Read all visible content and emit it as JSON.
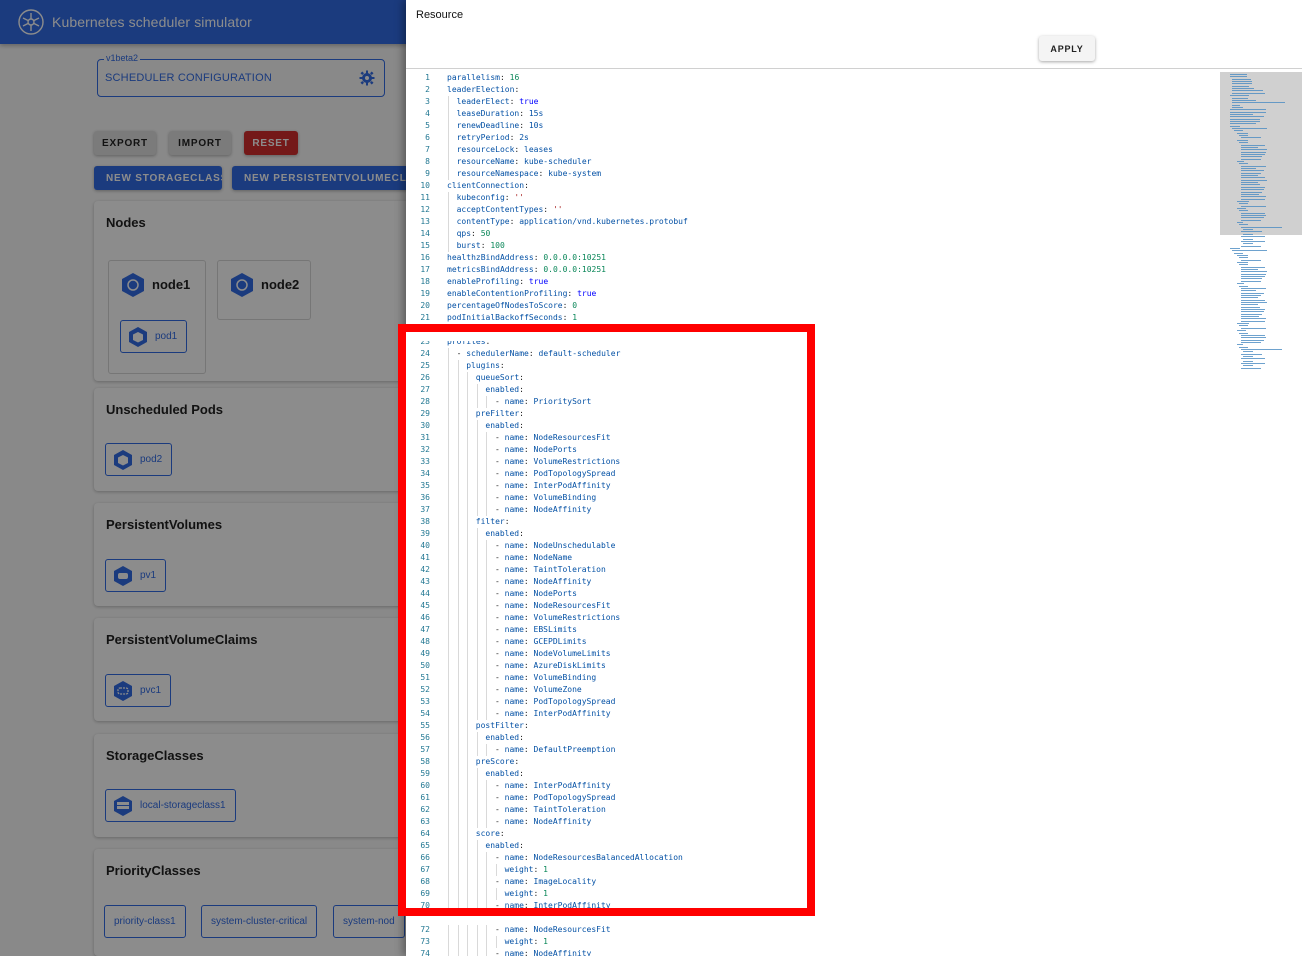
{
  "app": {
    "title": "Kubernetes scheduler simulator",
    "scheduler_config": {
      "legend": "v1beta2",
      "value": "SCHEDULER CONFIGURATION"
    },
    "buttons": {
      "export": "EXPORT",
      "import": "IMPORT",
      "reset": "RESET",
      "new_storageclass": "NEW STORAGECLASS",
      "new_pvc": "NEW PERSISTENTVOLUMECLAIM"
    },
    "sections": {
      "nodes": {
        "title": "Nodes",
        "nodes": [
          {
            "name": "node1",
            "pods": [
              "pod1"
            ]
          },
          {
            "name": "node2",
            "pods": []
          }
        ]
      },
      "unscheduled_pods": {
        "title": "Unscheduled Pods",
        "items": [
          "pod2"
        ]
      },
      "persistent_volumes": {
        "title": "PersistentVolumes",
        "items": [
          "pv1"
        ]
      },
      "persistent_volume_claims": {
        "title": "PersistentVolumeClaims",
        "items": [
          "pvc1"
        ]
      },
      "storage_classes": {
        "title": "StorageClasses",
        "items": [
          "local-storageclass1"
        ]
      },
      "priority_classes": {
        "title": "PriorityClasses",
        "items": [
          "priority-class1",
          "system-cluster-critical",
          "system-nod"
        ]
      }
    }
  },
  "drawer": {
    "title": "Resource",
    "apply_label": "APPLY",
    "editor": {
      "lines": [
        {
          "n": "1",
          "indent": 0,
          "key": "parallelism",
          "value": "16",
          "vtype": "n"
        },
        {
          "n": "2",
          "indent": 0,
          "key": "leaderElection",
          "value": "",
          "vtype": ""
        },
        {
          "n": "3",
          "indent": 1,
          "key": "leaderElect",
          "value": "true",
          "vtype": "b"
        },
        {
          "n": "4",
          "indent": 1,
          "key": "leaseDuration",
          "value": "15s",
          "vtype": "v"
        },
        {
          "n": "5",
          "indent": 1,
          "key": "renewDeadline",
          "value": "10s",
          "vtype": "v"
        },
        {
          "n": "6",
          "indent": 1,
          "key": "retryPeriod",
          "value": "2s",
          "vtype": "v"
        },
        {
          "n": "7",
          "indent": 1,
          "key": "resourceLock",
          "value": "leases",
          "vtype": "v"
        },
        {
          "n": "8",
          "indent": 1,
          "key": "resourceName",
          "value": "kube-scheduler",
          "vtype": "v"
        },
        {
          "n": "9",
          "indent": 1,
          "key": "resourceNamespace",
          "value": "kube-system",
          "vtype": "v"
        },
        {
          "n": "10",
          "indent": 0,
          "key": "clientConnection",
          "value": "",
          "vtype": ""
        },
        {
          "n": "11",
          "indent": 1,
          "key": "kubeconfig",
          "value": "''",
          "vtype": "s"
        },
        {
          "n": "12",
          "indent": 1,
          "key": "acceptContentTypes",
          "value": "''",
          "vtype": "s"
        },
        {
          "n": "13",
          "indent": 1,
          "key": "contentType",
          "value": "application/vnd.kubernetes.protobuf",
          "vtype": "v"
        },
        {
          "n": "14",
          "indent": 1,
          "key": "qps",
          "value": "50",
          "vtype": "n"
        },
        {
          "n": "15",
          "indent": 1,
          "key": "burst",
          "value": "100",
          "vtype": "n"
        },
        {
          "n": "16",
          "indent": 0,
          "key": "healthzBindAddress",
          "value": "0.0.0.0:10251",
          "vtype": "n"
        },
        {
          "n": "17",
          "indent": 0,
          "key": "metricsBindAddress",
          "value": "0.0.0.0:10251",
          "vtype": "n"
        },
        {
          "n": "18",
          "indent": 0,
          "key": "enableProfiling",
          "value": "true",
          "vtype": "b"
        },
        {
          "n": "19",
          "indent": 0,
          "key": "enableContentionProfiling",
          "value": "true",
          "vtype": "b"
        },
        {
          "n": "20",
          "indent": 0,
          "key": "percentageOfNodesToScore",
          "value": "0",
          "vtype": "n"
        },
        {
          "n": "21",
          "indent": 0,
          "key": "podInitialBackoffSeconds",
          "value": "1",
          "vtype": "n"
        },
        {
          "n": "22",
          "indent": 0,
          "key": "podMaxBackoffSeconds",
          "value": "10",
          "vtype": "n"
        },
        {
          "n": "23",
          "indent": 0,
          "key": "profiles",
          "value": "",
          "vtype": ""
        },
        {
          "n": "24",
          "indent": 1,
          "dash": true,
          "key": "schedulerName",
          "value": "default-scheduler",
          "vtype": "v"
        },
        {
          "n": "25",
          "indent": 2,
          "key": "plugins",
          "value": "",
          "vtype": ""
        },
        {
          "n": "26",
          "indent": 3,
          "key": "queueSort",
          "value": "",
          "vtype": ""
        },
        {
          "n": "27",
          "indent": 4,
          "key": "enabled",
          "value": "",
          "vtype": ""
        },
        {
          "n": "28",
          "indent": 5,
          "dash": true,
          "key": "name",
          "value": "PrioritySort",
          "vtype": "v"
        },
        {
          "n": "29",
          "indent": 3,
          "key": "preFilter",
          "value": "",
          "vtype": ""
        },
        {
          "n": "30",
          "indent": 4,
          "key": "enabled",
          "value": "",
          "vtype": ""
        },
        {
          "n": "31",
          "indent": 5,
          "dash": true,
          "key": "name",
          "value": "NodeResourcesFit",
          "vtype": "v"
        },
        {
          "n": "32",
          "indent": 5,
          "dash": true,
          "key": "name",
          "value": "NodePorts",
          "vtype": "v"
        },
        {
          "n": "33",
          "indent": 5,
          "dash": true,
          "key": "name",
          "value": "VolumeRestrictions",
          "vtype": "v"
        },
        {
          "n": "34",
          "indent": 5,
          "dash": true,
          "key": "name",
          "value": "PodTopologySpread",
          "vtype": "v"
        },
        {
          "n": "35",
          "indent": 5,
          "dash": true,
          "key": "name",
          "value": "InterPodAffinity",
          "vtype": "v"
        },
        {
          "n": "36",
          "indent": 5,
          "dash": true,
          "key": "name",
          "value": "VolumeBinding",
          "vtype": "v"
        },
        {
          "n": "37",
          "indent": 5,
          "dash": true,
          "key": "name",
          "value": "NodeAffinity",
          "vtype": "v"
        },
        {
          "n": "38",
          "indent": 3,
          "key": "filter",
          "value": "",
          "vtype": ""
        },
        {
          "n": "39",
          "indent": 4,
          "key": "enabled",
          "value": "",
          "vtype": ""
        },
        {
          "n": "40",
          "indent": 5,
          "dash": true,
          "key": "name",
          "value": "NodeUnschedulable",
          "vtype": "v"
        },
        {
          "n": "41",
          "indent": 5,
          "dash": true,
          "key": "name",
          "value": "NodeName",
          "vtype": "v"
        },
        {
          "n": "42",
          "indent": 5,
          "dash": true,
          "key": "name",
          "value": "TaintToleration",
          "vtype": "v"
        },
        {
          "n": "43",
          "indent": 5,
          "dash": true,
          "key": "name",
          "value": "NodeAffinity",
          "vtype": "v"
        },
        {
          "n": "44",
          "indent": 5,
          "dash": true,
          "key": "name",
          "value": "NodePorts",
          "vtype": "v"
        },
        {
          "n": "45",
          "indent": 5,
          "dash": true,
          "key": "name",
          "value": "NodeResourcesFit",
          "vtype": "v"
        },
        {
          "n": "46",
          "indent": 5,
          "dash": true,
          "key": "name",
          "value": "VolumeRestrictions",
          "vtype": "v"
        },
        {
          "n": "47",
          "indent": 5,
          "dash": true,
          "key": "name",
          "value": "EBSLimits",
          "vtype": "v"
        },
        {
          "n": "48",
          "indent": 5,
          "dash": true,
          "key": "name",
          "value": "GCEPDLimits",
          "vtype": "v"
        },
        {
          "n": "49",
          "indent": 5,
          "dash": true,
          "key": "name",
          "value": "NodeVolumeLimits",
          "vtype": "v"
        },
        {
          "n": "50",
          "indent": 5,
          "dash": true,
          "key": "name",
          "value": "AzureDiskLimits",
          "vtype": "v"
        },
        {
          "n": "51",
          "indent": 5,
          "dash": true,
          "key": "name",
          "value": "VolumeBinding",
          "vtype": "v"
        },
        {
          "n": "52",
          "indent": 5,
          "dash": true,
          "key": "name",
          "value": "VolumeZone",
          "vtype": "v"
        },
        {
          "n": "53",
          "indent": 5,
          "dash": true,
          "key": "name",
          "value": "PodTopologySpread",
          "vtype": "v"
        },
        {
          "n": "54",
          "indent": 5,
          "dash": true,
          "key": "name",
          "value": "InterPodAffinity",
          "vtype": "v"
        },
        {
          "n": "55",
          "indent": 3,
          "key": "postFilter",
          "value": "",
          "vtype": ""
        },
        {
          "n": "56",
          "indent": 4,
          "key": "enabled",
          "value": "",
          "vtype": ""
        },
        {
          "n": "57",
          "indent": 5,
          "dash": true,
          "key": "name",
          "value": "DefaultPreemption",
          "vtype": "v"
        },
        {
          "n": "58",
          "indent": 3,
          "key": "preScore",
          "value": "",
          "vtype": ""
        },
        {
          "n": "59",
          "indent": 4,
          "key": "enabled",
          "value": "",
          "vtype": ""
        },
        {
          "n": "60",
          "indent": 5,
          "dash": true,
          "key": "name",
          "value": "InterPodAffinity",
          "vtype": "v"
        },
        {
          "n": "61",
          "indent": 5,
          "dash": true,
          "key": "name",
          "value": "PodTopologySpread",
          "vtype": "v"
        },
        {
          "n": "62",
          "indent": 5,
          "dash": true,
          "key": "name",
          "value": "TaintToleration",
          "vtype": "v"
        },
        {
          "n": "63",
          "indent": 5,
          "dash": true,
          "key": "name",
          "value": "NodeAffinity",
          "vtype": "v"
        },
        {
          "n": "64",
          "indent": 3,
          "key": "score",
          "value": "",
          "vtype": ""
        },
        {
          "n": "65",
          "indent": 4,
          "key": "enabled",
          "value": "",
          "vtype": ""
        },
        {
          "n": "66",
          "indent": 5,
          "dash": true,
          "key": "name",
          "value": "NodeResourcesBalancedAllocation",
          "vtype": "v"
        },
        {
          "n": "67",
          "indent": 6,
          "key": "weight",
          "value": "1",
          "vtype": "n"
        },
        {
          "n": "68",
          "indent": 5,
          "dash": true,
          "key": "name",
          "value": "ImageLocality",
          "vtype": "v"
        },
        {
          "n": "69",
          "indent": 6,
          "key": "weight",
          "value": "1",
          "vtype": "n"
        },
        {
          "n": "70",
          "indent": 5,
          "dash": true,
          "key": "name",
          "value": "InterPodAffinity",
          "vtype": "v"
        },
        {
          "n": "71",
          "indent": 6,
          "key": "weight",
          "value": "1",
          "vtype": "n"
        },
        {
          "n": "72",
          "indent": 5,
          "dash": true,
          "key": "name",
          "value": "NodeResourcesFit",
          "vtype": "v"
        },
        {
          "n": "73",
          "indent": 6,
          "key": "weight",
          "value": "1",
          "vtype": "n"
        },
        {
          "n": "74",
          "indent": 5,
          "dash": true,
          "key": "name",
          "value": "NodeAffinity",
          "vtype": "v"
        }
      ]
    }
  },
  "annotation": {
    "color": "#ff0000"
  },
  "colors": {
    "brand": "#326ce5",
    "danger": "#d32f2f"
  }
}
